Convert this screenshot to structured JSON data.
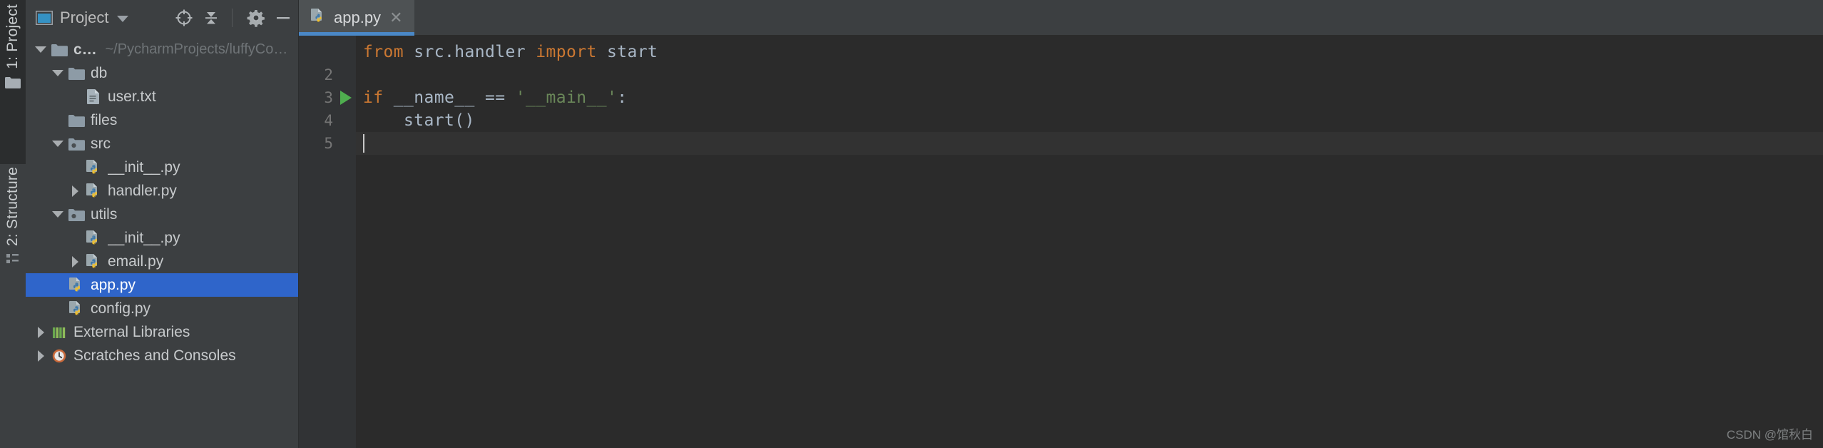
{
  "toolwindow_strip": {
    "project_label": "1: Project",
    "structure_label": "2: Structure",
    "folder_icon": "folder-icon",
    "structure_icon": "structure-grid-icon"
  },
  "project_panel": {
    "title": "Project",
    "title_icon": "project-window-icon",
    "dropdown_icon": "chevron-down-icon",
    "actions": [
      {
        "name": "select-opened-file-icon",
        "glyph": "crosshair-icon"
      },
      {
        "name": "collapse-all-icon",
        "glyph": "collapse-all-icon"
      },
      {
        "name": "settings-icon",
        "glyph": "gear-icon"
      },
      {
        "name": "hide-icon",
        "glyph": "minimize-icon"
      }
    ],
    "tree": [
      {
        "label": "crm",
        "path": "~/PycharmProjects/luffyCourse/crm",
        "icon": "folder-icon",
        "twisty": "down",
        "indent": 0,
        "bold": true,
        "selected": false
      },
      {
        "label": "db",
        "path": "",
        "icon": "folder-icon",
        "twisty": "down",
        "indent": 1,
        "bold": false,
        "selected": false
      },
      {
        "label": "user.txt",
        "path": "",
        "icon": "text-file-icon",
        "twisty": "none",
        "indent": 2,
        "bold": false,
        "selected": false
      },
      {
        "label": "files",
        "path": "",
        "icon": "folder-icon",
        "twisty": "none",
        "indent": 1,
        "bold": false,
        "selected": false
      },
      {
        "label": "src",
        "path": "",
        "icon": "source-root-icon",
        "twisty": "down",
        "indent": 1,
        "bold": false,
        "selected": false
      },
      {
        "label": "__init__.py",
        "path": "",
        "icon": "python-file-icon",
        "twisty": "none",
        "indent": 2,
        "bold": false,
        "selected": false
      },
      {
        "label": "handler.py",
        "path": "",
        "icon": "python-file-icon",
        "twisty": "right",
        "indent": 2,
        "bold": false,
        "selected": false
      },
      {
        "label": "utils",
        "path": "",
        "icon": "source-root-icon",
        "twisty": "down",
        "indent": 1,
        "bold": false,
        "selected": false
      },
      {
        "label": "__init__.py",
        "path": "",
        "icon": "python-file-icon",
        "twisty": "none",
        "indent": 2,
        "bold": false,
        "selected": false
      },
      {
        "label": "email.py",
        "path": "",
        "icon": "python-file-icon",
        "twisty": "right",
        "indent": 2,
        "bold": false,
        "selected": false
      },
      {
        "label": "app.py",
        "path": "",
        "icon": "python-file-icon",
        "twisty": "none",
        "indent": 1,
        "bold": false,
        "selected": true
      },
      {
        "label": "config.py",
        "path": "",
        "icon": "python-file-icon",
        "twisty": "none",
        "indent": 1,
        "bold": false,
        "selected": false
      },
      {
        "label": "External Libraries",
        "path": "",
        "icon": "libraries-icon",
        "twisty": "right",
        "indent": 0,
        "bold": false,
        "selected": false
      },
      {
        "label": "Scratches and Consoles",
        "path": "",
        "icon": "scratches-icon",
        "twisty": "right",
        "indent": 0,
        "bold": false,
        "selected": false
      }
    ]
  },
  "editor": {
    "tab": {
      "label": "app.py",
      "icon": "python-file-icon",
      "close_icon": "close-icon"
    },
    "lines": [
      {
        "number": "",
        "run": false,
        "current": false,
        "tokens": [
          {
            "t": "from ",
            "c": "kw"
          },
          {
            "t": "src.handler ",
            "c": "plain"
          },
          {
            "t": "import ",
            "c": "kw"
          },
          {
            "t": "start",
            "c": "plain"
          }
        ]
      },
      {
        "number": "2",
        "run": false,
        "current": false,
        "tokens": []
      },
      {
        "number": "3",
        "run": true,
        "current": false,
        "tokens": [
          {
            "t": "if ",
            "c": "kw"
          },
          {
            "t": "__name__ == ",
            "c": "plain"
          },
          {
            "t": "'__main__'",
            "c": "str"
          },
          {
            "t": ":",
            "c": "plain"
          }
        ]
      },
      {
        "number": "4",
        "run": false,
        "current": false,
        "tokens": [
          {
            "t": "    start()",
            "c": "plain"
          }
        ]
      },
      {
        "number": "5",
        "run": false,
        "current": true,
        "tokens": []
      }
    ]
  },
  "watermark": "CSDN @馆秋白",
  "colors": {
    "selection_blue": "#2f65ca",
    "tab_underline": "#4a88c7",
    "keyword_orange": "#cc7832",
    "string_green": "#6a8759",
    "run_green": "#4fae4f",
    "editor_bg": "#2b2b2b",
    "panel_bg": "#3c3f41"
  }
}
